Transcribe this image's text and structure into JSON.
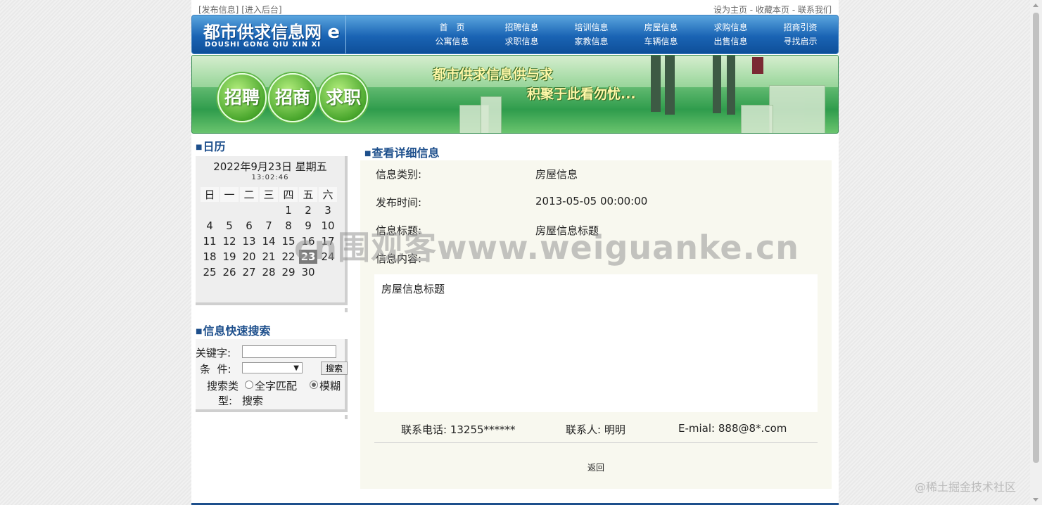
{
  "topbar": {
    "publish": "[发布信息]",
    "admin": "[进入后台]",
    "set_home": "设为主页",
    "favorite": "收藏本页",
    "contact": "联系我们",
    "sep": "-"
  },
  "logo": {
    "title": "都市供求信息网",
    "letter": "e",
    "subtitle": "DOUSHI  GONG QIU XIN XI"
  },
  "nav": {
    "row1": [
      "首　页",
      "招聘信息",
      "培训信息",
      "房屋信息",
      "求购信息",
      "招商引资"
    ],
    "row2": [
      "公寓信息",
      "求职信息",
      "家教信息",
      "车辆信息",
      "出售信息",
      "寻找启示"
    ]
  },
  "banner": {
    "circles": [
      "招聘",
      "招商",
      "求职"
    ],
    "slogan1": "都市供求信息供与求",
    "slogan2": "积聚于此看勿忧..."
  },
  "calendar": {
    "title": "日历",
    "date": "2022年9月23日 星期五",
    "time": "13:02:46",
    "weekdays": [
      "日",
      "一",
      "二",
      "三",
      "四",
      "五",
      "六"
    ],
    "weeks": [
      [
        "",
        "",
        "",
        "",
        "1",
        "2",
        "3"
      ],
      [
        "4",
        "5",
        "6",
        "7",
        "8",
        "9",
        "10"
      ],
      [
        "11",
        "12",
        "13",
        "14",
        "15",
        "16",
        "17"
      ],
      [
        "18",
        "19",
        "20",
        "21",
        "22",
        "23",
        "24"
      ],
      [
        "25",
        "26",
        "27",
        "28",
        "29",
        "30",
        ""
      ]
    ],
    "today": "23"
  },
  "search": {
    "title": "信息快速搜索",
    "keyword_label": "关键字:",
    "keyword_value": "",
    "condition_label": "条  件:",
    "condition_value": "",
    "button": "搜索",
    "type_label_1": "搜索类",
    "type_label_2": "型:",
    "option_exact": "全字匹配",
    "option_fuzzy_1": "模糊",
    "option_fuzzy_2": "搜索"
  },
  "detail": {
    "title": "查看详细信息",
    "type_label": "信息类别:",
    "type_value": "房屋信息",
    "time_label": "发布时间:",
    "time_value": "2013-05-05 00:00:00",
    "subject_label": "信息标题:",
    "subject_value": "房屋信息标题",
    "content_label": "信息内容:",
    "content_value": "房屋信息标题",
    "phone_label": "联系电话:",
    "phone_value": "13255******",
    "person_label": "联系人:",
    "person_value": "明明",
    "email_label": "E-mial:",
    "email_value": "888@8*.com",
    "back": "返回"
  },
  "overlays": {
    "watermark": "cn围观客www.weiguanke.cn",
    "juejin": "@稀土掘金技术社区"
  },
  "colors": {
    "title_blue": "#1d4f8c",
    "header_blue": "#1a64b4",
    "banner_green": "#2f9c4c",
    "detail_bg": "#f8f8ef"
  }
}
